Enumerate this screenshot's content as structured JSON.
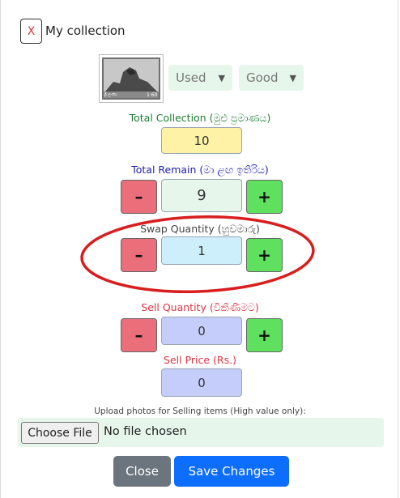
{
  "header": {
    "close_x": "X",
    "title": "My collection"
  },
  "stamp": {
    "country_text": "ශ්‍රී ලංකා",
    "value_text": "1·60"
  },
  "condition_select": {
    "value": "Used"
  },
  "grade_select": {
    "value": "Good"
  },
  "total_collection": {
    "label": "Total Collection (මුළු ප්‍රමාණය)",
    "value": "10",
    "color": "#fdf2a6"
  },
  "total_remain": {
    "label": "Total Remain (මා ළඟ ඉතිරිය)",
    "value": "9",
    "color": "#e6f6ea"
  },
  "swap_quantity": {
    "label": "Swap Quantity (හුවමාරු)",
    "value": "1",
    "color": "#cdeffc"
  },
  "sell_quantity": {
    "label": "Sell Quantity (විකිණීමට)",
    "value": "0",
    "color": "#c5cdfb"
  },
  "sell_price": {
    "label": "Sell Price (Rs.)",
    "value": "0",
    "color": "#c5cdfb"
  },
  "controls": {
    "minus": "–",
    "plus": "+"
  },
  "upload": {
    "label": "Upload photos for Selling items (High value only):",
    "button": "Choose File",
    "status": "No file chosen"
  },
  "footer": {
    "close_label": "Close",
    "save_label": "Save Changes"
  },
  "colors": {
    "minus_bg": "#eb6f7b",
    "plus_bg": "#5fe05f",
    "annotation": "#d81e1e",
    "primary": "#0d6efd",
    "secondary": "#6c757d"
  }
}
